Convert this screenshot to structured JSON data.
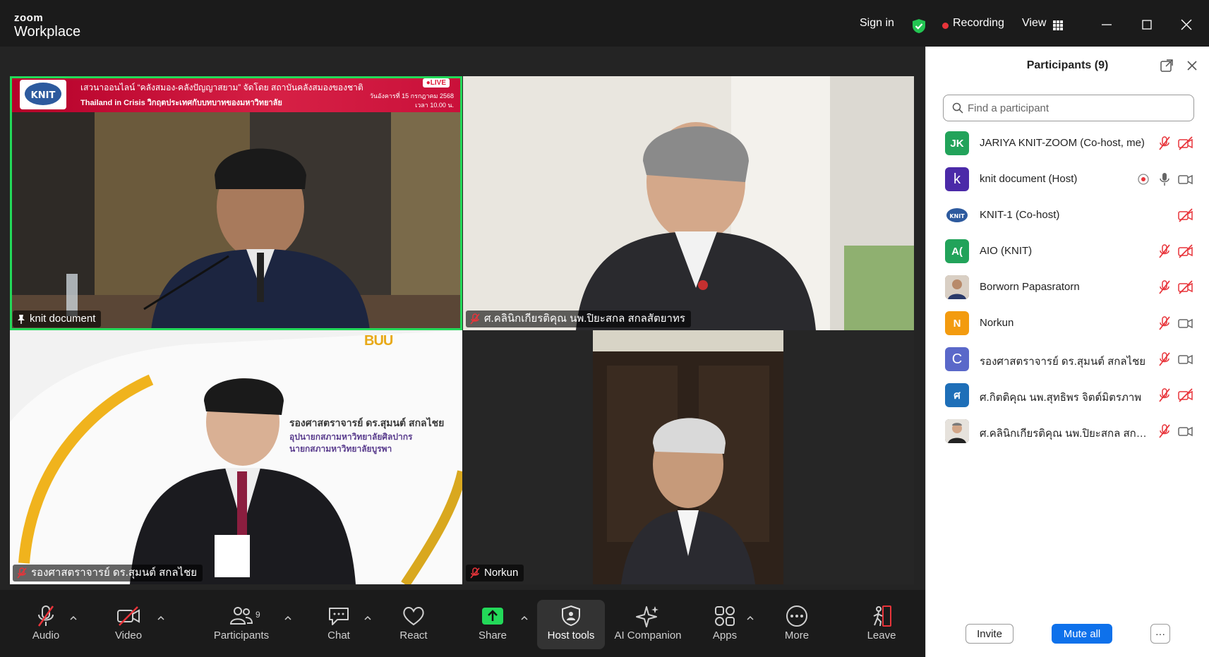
{
  "app": {
    "brand_top": "zoom",
    "brand_bottom": "Workplace"
  },
  "titlebar": {
    "sign_in": "Sign in",
    "recording": "Recording",
    "view": "View"
  },
  "videos": [
    {
      "name": "knit document",
      "banner_line1": "เสวนาออนไลน์ “คลังสมอง-คลังปัญญาสยาม” จัดโดย สถาบันคลังสมองของชาติ",
      "banner_line2": "Thailand in Crisis วิกฤตประเทศกับบทบาทของมหาวิทยาลัย",
      "banner_date": "วันอังคารที่ 15 กรกฎาคม 2568",
      "banner_time": "เวลา 10.00 น.",
      "live": "●LIVE",
      "logo": "KNIT"
    },
    {
      "name": "ศ.คลินิกเกียรติคุณ นพ.ปิยะสกล  สกลสัตยาทร"
    },
    {
      "name": "รองศาสตราจารย์ ดร.สุมนต์ สกลไชย",
      "card_title": "รองศาสตราจารย์ ดร.สุมนต์ สกลไชย",
      "card_sub1": "อุปนายกสภามหาวิทยาลัยศิลปากร",
      "card_sub2": "นายกสภามหาวิทยาลัยบูรพา",
      "buu": "BUU"
    },
    {
      "name": "Norkun"
    }
  ],
  "toolbar": {
    "audio": "Audio",
    "video": "Video",
    "participants": "Participants",
    "participants_count": "9",
    "chat": "Chat",
    "react": "React",
    "share": "Share",
    "host_tools": "Host tools",
    "ai_companion": "AI Companion",
    "apps": "Apps",
    "more": "More",
    "leave": "Leave"
  },
  "panel": {
    "title": "Participants (9)",
    "search_placeholder": "Find a participant",
    "participants": [
      {
        "initials": "JK",
        "name": "JARIYA KNIT-ZOOM (Co-host, me)",
        "color": "#22a35a",
        "mic": "muted",
        "cam": "off"
      },
      {
        "initials": "k",
        "name": "knit document (Host)",
        "color": "#4b2aa8",
        "mic": "on",
        "cam": "on",
        "recording": true
      },
      {
        "initials": "KNIT",
        "name": "KNIT-1 (Co-host)",
        "color": "#ffffff",
        "mic": "none",
        "cam": "off"
      },
      {
        "initials": "A(",
        "name": "AIO (KNIT)",
        "color": "#22a35a",
        "mic": "muted",
        "cam": "off"
      },
      {
        "initials": "",
        "name": "Borworn Papasratorn",
        "color": "#8a6a55",
        "mic": "muted",
        "cam": "off"
      },
      {
        "initials": "N",
        "name": "Norkun",
        "color": "#f39b0f",
        "mic": "muted",
        "cam": "on"
      },
      {
        "initials": "C",
        "name": "รองศาสตราจารย์ ดร.สุมนต์ สกลไชย",
        "color": "#5a68c9",
        "mic": "muted",
        "cam": "on"
      },
      {
        "initials": "ศ",
        "name": "ศ.กิตติคุณ นพ.สุทธิพร  จิตต์มิตรภาพ",
        "color": "#1e6fb8",
        "mic": "muted",
        "cam": "off"
      },
      {
        "initials": "",
        "name": "ศ.คลินิกเกียรติคุณ นพ.ปิยะสกล  สกลส...",
        "color": "#6b6b6b",
        "mic": "muted",
        "cam": "on"
      }
    ],
    "invite": "Invite",
    "mute_all": "Mute all",
    "more": "···"
  }
}
